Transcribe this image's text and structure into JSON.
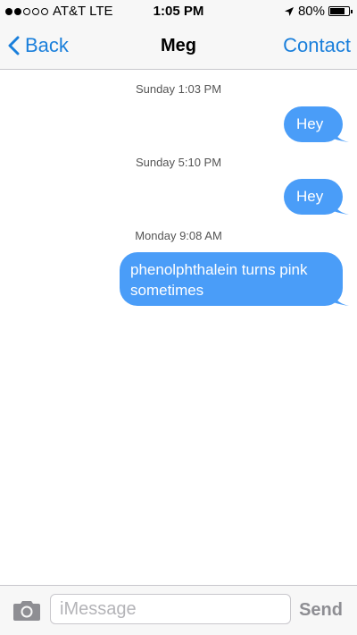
{
  "status_bar": {
    "signal_full": 2,
    "signal_empty": 3,
    "carrier": "AT&T LTE",
    "time": "1:05 PM",
    "battery_percent": 0.8,
    "battery_label": "80%",
    "location_icon": "location-arrow-icon"
  },
  "nav": {
    "back_label": "Back",
    "title": "Meg",
    "contact_label": "Contact"
  },
  "conversation": {
    "bubble_color": "#4a9df8",
    "items": [
      {
        "timestamp": "Sunday 1:03 PM",
        "message": "Hey"
      },
      {
        "timestamp": "Sunday 5:10 PM",
        "message": "Hey"
      },
      {
        "timestamp": "Monday 9:08 AM",
        "message": "phenolphthalein turns pink sometimes"
      }
    ]
  },
  "input_bar": {
    "camera_icon": "camera-icon",
    "placeholder": "iMessage",
    "value": "",
    "send_label": "Send"
  },
  "colors": {
    "accent": "#1a7fdb",
    "send_disabled": "#8e8e93"
  }
}
